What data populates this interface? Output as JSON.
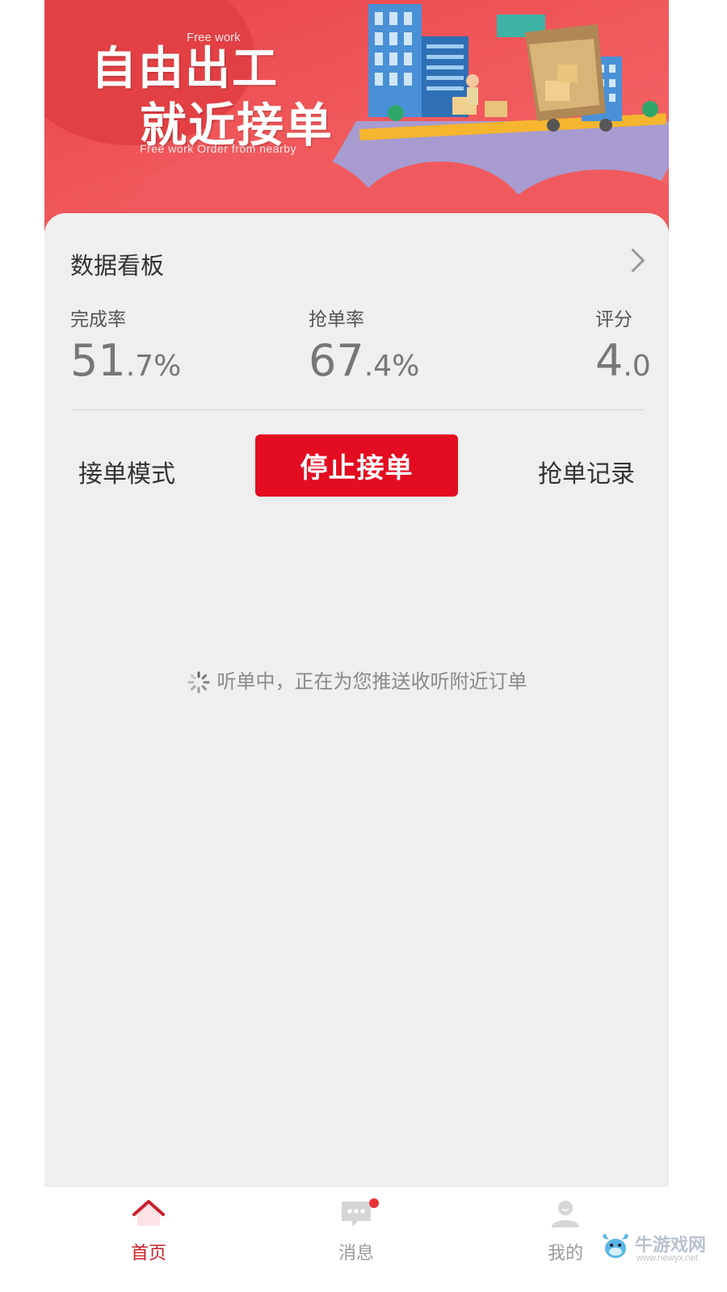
{
  "banner": {
    "title_line1": "自由出工",
    "title_line2": "就近接单",
    "subtitle_top": "Free work",
    "subtitle_bottom": "Free work Order from nearby"
  },
  "dashboard": {
    "title": "数据看板",
    "stats": [
      {
        "label": "完成率",
        "int": "51",
        "dec": ".7%"
      },
      {
        "label": "抢单率",
        "int": "67",
        "dec": ".4%"
      },
      {
        "label": "评分",
        "int": "4",
        "dec": ".0"
      }
    ]
  },
  "actions": {
    "mode_label": "接单模式",
    "stop_label": "停止接单",
    "record_label": "抢单记录"
  },
  "status": {
    "listening_text": "听单中，正在为您推送收听附近订单"
  },
  "tabbar": {
    "items": [
      {
        "label": "首页",
        "icon": "home-icon",
        "active": true
      },
      {
        "label": "消息",
        "icon": "message-icon",
        "active": false,
        "badge": true
      },
      {
        "label": "我的",
        "icon": "user-icon",
        "active": false
      }
    ],
    "active_color": "#c8202c",
    "inactive_color": "#999999"
  },
  "watermark": {
    "name": "牛游戏网",
    "url": "www.newyx.net"
  },
  "colors": {
    "accent": "#e30c20",
    "banner": "#f05a5e",
    "background": "#efefef"
  }
}
